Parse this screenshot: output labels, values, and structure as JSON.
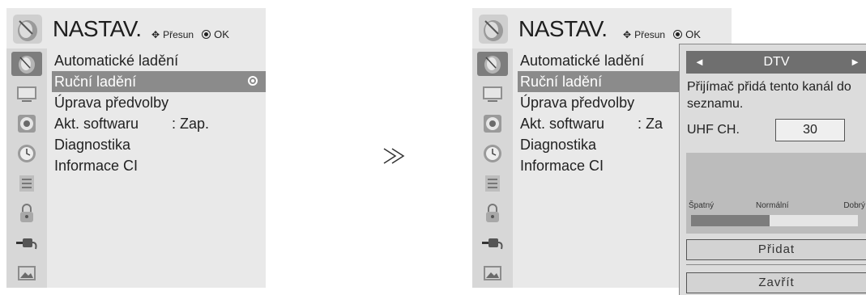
{
  "left_menu": {
    "title": "NASTAV.",
    "hint_move": "Přesun",
    "hint_ok": "OK",
    "items": [
      {
        "label": "Automatické ladění",
        "value": ""
      },
      {
        "label": "Ruční ladění",
        "value": ""
      },
      {
        "label": "Úprava předvolby",
        "value": ""
      },
      {
        "label": "Akt. softwaru",
        "value": ": Zap."
      },
      {
        "label": "Diagnostika",
        "value": ""
      },
      {
        "label": "Informace CI",
        "value": ""
      }
    ],
    "selected_index": 1
  },
  "arrow_glyph": "≫",
  "right_menu": {
    "title": "NASTAV.",
    "hint_move": "Přesun",
    "hint_ok": "OK",
    "items": [
      {
        "label": "Automatické ladění",
        "value": ""
      },
      {
        "label": "Ruční ladění",
        "value": ""
      },
      {
        "label": "Úprava předvolby",
        "value": ""
      },
      {
        "label": "Akt. softwaru",
        "value": ": Za"
      },
      {
        "label": "Diagnostika",
        "value": ""
      },
      {
        "label": "Informace CI",
        "value": ""
      }
    ],
    "selected_index": 1
  },
  "popup": {
    "mode_left": "◄",
    "mode": "DTV",
    "mode_right": "►",
    "description": "Přijímač přidá tento kanál do seznamu.",
    "channel_label": "UHF CH.",
    "channel_value": "30",
    "signal_labels": {
      "bad": "Špatný",
      "normal": "Normální",
      "good": "Dobrý"
    },
    "signal_level": 0.47,
    "add_button": "Přidat",
    "close_button": "Zavřít"
  },
  "colors": {
    "menu_bg": "#e9e9e9",
    "selection": "#8b8b8b",
    "sidebar_active": "#7d7d7d"
  },
  "sidebar_icons": [
    "satellite-dish-icon",
    "monitor-icon",
    "speaker-icon",
    "clock-icon",
    "calendar-icon",
    "padlock-icon",
    "plug-icon",
    "photo-icon"
  ]
}
